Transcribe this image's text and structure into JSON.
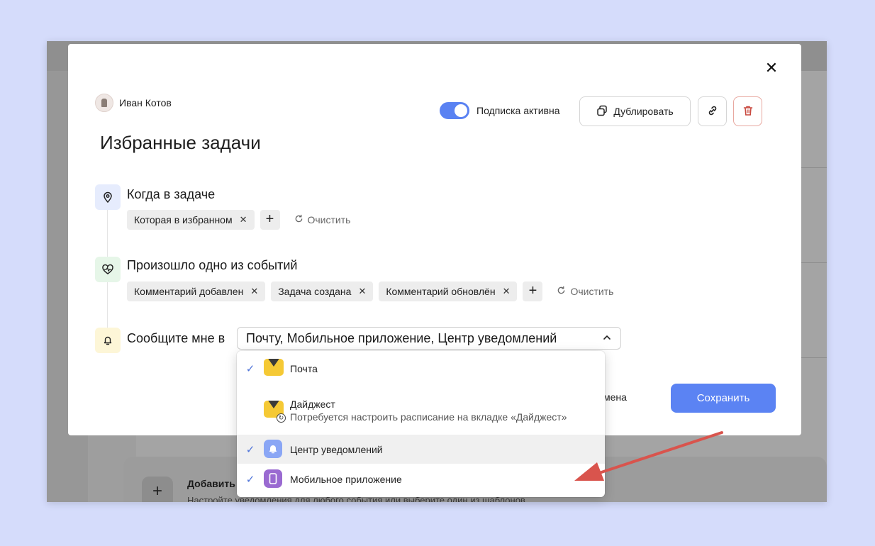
{
  "author": {
    "name": "Иван Котов"
  },
  "modal": {
    "title": "Избранные задачи",
    "close_label": "✕",
    "subscription_toggle": {
      "label": "Подписка активна",
      "on": true
    },
    "duplicate_label": "Дублировать",
    "cancel_label": "мена",
    "save_label": "Сохранить"
  },
  "steps": [
    {
      "title": "Когда в задаче",
      "icon": "location-pin-icon",
      "chips": [
        "Которая в избранном"
      ],
      "clear_label": "Очистить"
    },
    {
      "title": "Произошло одно из событий",
      "icon": "heart-pulse-icon",
      "chips": [
        "Комментарий добавлен",
        "Задача создана",
        "Комментарий обновлён"
      ],
      "clear_label": "Очистить"
    },
    {
      "title": "Сообщите мне в",
      "icon": "bell-icon",
      "selected_value": "Почту, Мобильное приложение, Центр уведомлений"
    }
  ],
  "dropdown": {
    "options": [
      {
        "label": "Почта",
        "checked": true,
        "icon": "mail-icon"
      },
      {
        "label": "Дайджест",
        "sublabel": "Потребуется настроить расписание на вкладке «Дайджест»",
        "checked": false,
        "icon": "digest-mail-icon"
      },
      {
        "label": "Центр уведомлений",
        "checked": true,
        "icon": "notification-bell-icon"
      },
      {
        "label": "Мобильное приложение",
        "checked": true,
        "icon": "mobile-app-icon"
      }
    ]
  },
  "background": {
    "card_title": "Добавить",
    "card_subtitle": "Настройте уведомления для любого события или выберите один из шаблонов"
  },
  "colors": {
    "page_bg": "#d5dcfb",
    "accent": "#5b83f3",
    "annotation_arrow": "#d9544d"
  }
}
